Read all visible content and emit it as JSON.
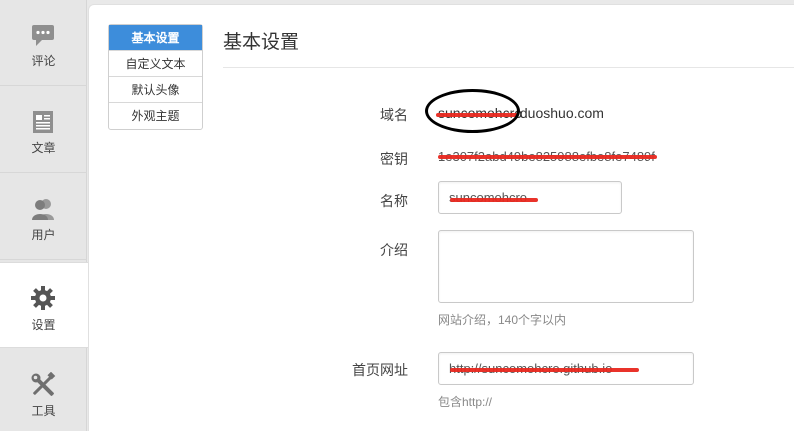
{
  "rail": {
    "items": [
      {
        "label": "评论",
        "icon": "comment-icon"
      },
      {
        "label": "文章",
        "icon": "article-icon"
      },
      {
        "label": "用户",
        "icon": "users-icon"
      },
      {
        "label": "设置",
        "icon": "gear-icon"
      },
      {
        "label": "工具",
        "icon": "tools-icon"
      }
    ],
    "active": "设置"
  },
  "subtabs": [
    {
      "label": "基本设置",
      "active": true
    },
    {
      "label": "自定义文本",
      "active": false
    },
    {
      "label": "默认头像",
      "active": false
    },
    {
      "label": "外观主题",
      "active": false
    }
  ],
  "page_title": "基本设置",
  "form": {
    "domain_label": "域名",
    "domain_suffix": ".duoshuo.com",
    "domain_prefix": "suncomohcro",
    "key_label": "密钥",
    "key_value": "1e307f2abd49be825988efbe8fe7489f",
    "name_label": "名称",
    "name_value": "suncomohcro",
    "intro_label": "介绍",
    "intro_value": "",
    "intro_hint": "网站介绍，140个字以内",
    "home_label": "首页网址",
    "home_value": "http://suncomohcro.github.io",
    "home_hint": "包含http://"
  },
  "colors": {
    "accent": "#3d8ddb",
    "redaction": "#e8281f"
  }
}
